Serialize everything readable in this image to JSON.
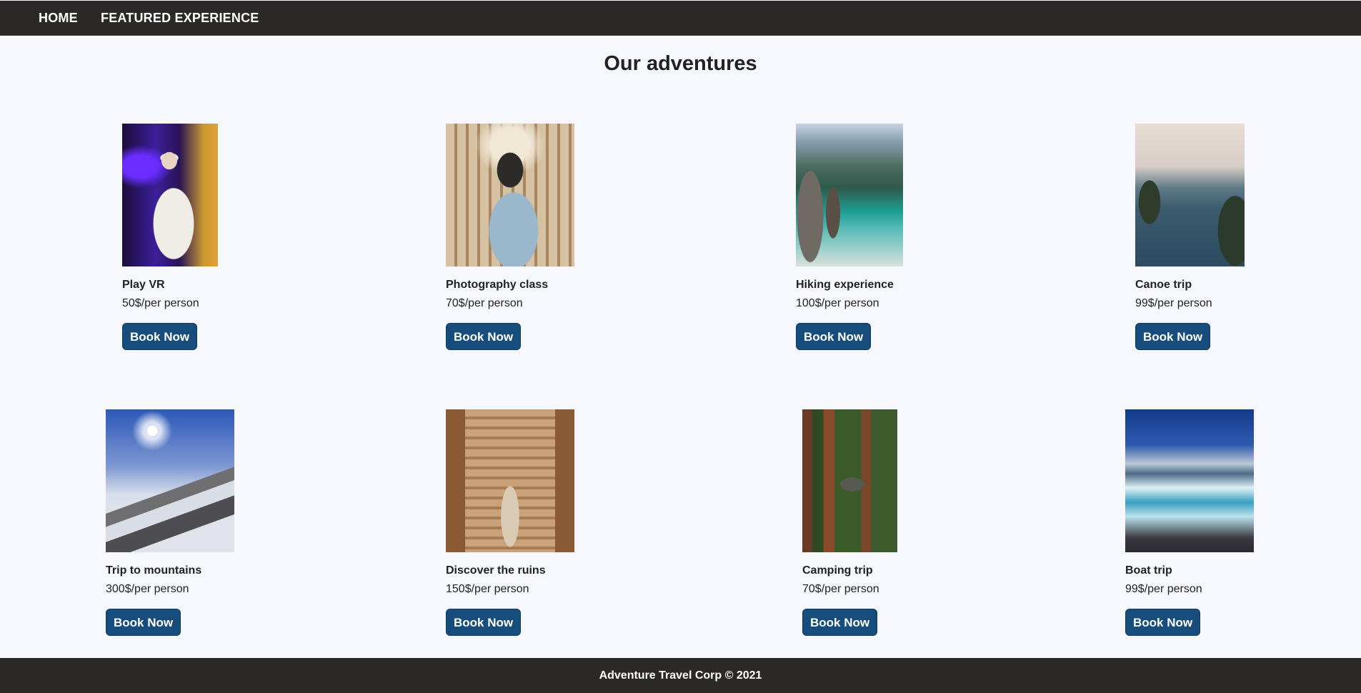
{
  "nav": {
    "home": "HOME",
    "featured": "FEATURED EXPERIENCE"
  },
  "heading": "Our adventures",
  "cards": [
    {
      "title": "Play VR",
      "price": "50$/per person",
      "button": "Book Now",
      "image_icon": "vr-photo"
    },
    {
      "title": "Photography class",
      "price": "70$/per person",
      "button": "Book Now",
      "image_icon": "photographer-photo"
    },
    {
      "title": "Hiking experience",
      "price": "100$/per person",
      "button": "Book Now",
      "image_icon": "lake-hiker-photo"
    },
    {
      "title": "Canoe trip",
      "price": "99$/per person",
      "button": "Book Now",
      "image_icon": "lake-canoe-photo"
    },
    {
      "title": "Trip to mountains",
      "price": "300$/per person",
      "button": "Book Now",
      "image_icon": "mountain-photo"
    },
    {
      "title": "Discover the ruins",
      "price": "150$/per person",
      "button": "Book Now",
      "image_icon": "ruins-photo"
    },
    {
      "title": "Camping trip",
      "price": "70$/per person",
      "button": "Book Now",
      "image_icon": "camping-van-photo"
    },
    {
      "title": "Boat trip",
      "price": "99$/per person",
      "button": "Book Now",
      "image_icon": "ocean-waves-photo"
    }
  ],
  "footer": "Adventure Travel Corp © 2021",
  "colors": {
    "nav_bg": "#2a2927",
    "button_bg": "#164d7c",
    "page_bg": "#f7f8fd"
  }
}
